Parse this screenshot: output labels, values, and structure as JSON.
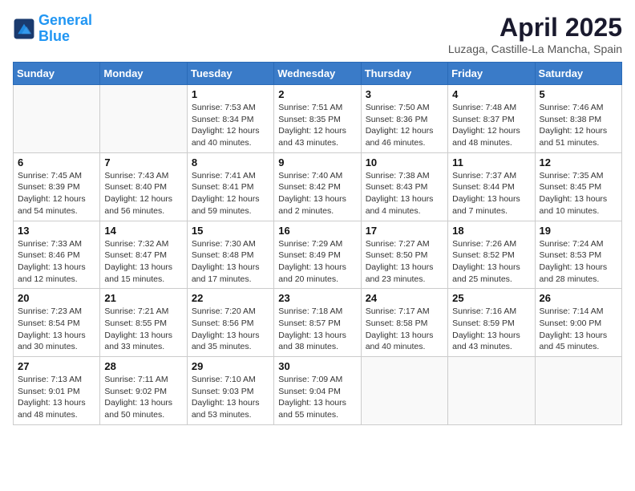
{
  "logo": {
    "line1": "General",
    "line2": "Blue"
  },
  "title": "April 2025",
  "location": "Luzaga, Castille-La Mancha, Spain",
  "weekdays": [
    "Sunday",
    "Monday",
    "Tuesday",
    "Wednesday",
    "Thursday",
    "Friday",
    "Saturday"
  ],
  "weeks": [
    [
      {
        "day": "",
        "sunrise": "",
        "sunset": "",
        "daylight": ""
      },
      {
        "day": "",
        "sunrise": "",
        "sunset": "",
        "daylight": ""
      },
      {
        "day": "1",
        "sunrise": "Sunrise: 7:53 AM",
        "sunset": "Sunset: 8:34 PM",
        "daylight": "Daylight: 12 hours and 40 minutes."
      },
      {
        "day": "2",
        "sunrise": "Sunrise: 7:51 AM",
        "sunset": "Sunset: 8:35 PM",
        "daylight": "Daylight: 12 hours and 43 minutes."
      },
      {
        "day": "3",
        "sunrise": "Sunrise: 7:50 AM",
        "sunset": "Sunset: 8:36 PM",
        "daylight": "Daylight: 12 hours and 46 minutes."
      },
      {
        "day": "4",
        "sunrise": "Sunrise: 7:48 AM",
        "sunset": "Sunset: 8:37 PM",
        "daylight": "Daylight: 12 hours and 48 minutes."
      },
      {
        "day": "5",
        "sunrise": "Sunrise: 7:46 AM",
        "sunset": "Sunset: 8:38 PM",
        "daylight": "Daylight: 12 hours and 51 minutes."
      }
    ],
    [
      {
        "day": "6",
        "sunrise": "Sunrise: 7:45 AM",
        "sunset": "Sunset: 8:39 PM",
        "daylight": "Daylight: 12 hours and 54 minutes."
      },
      {
        "day": "7",
        "sunrise": "Sunrise: 7:43 AM",
        "sunset": "Sunset: 8:40 PM",
        "daylight": "Daylight: 12 hours and 56 minutes."
      },
      {
        "day": "8",
        "sunrise": "Sunrise: 7:41 AM",
        "sunset": "Sunset: 8:41 PM",
        "daylight": "Daylight: 12 hours and 59 minutes."
      },
      {
        "day": "9",
        "sunrise": "Sunrise: 7:40 AM",
        "sunset": "Sunset: 8:42 PM",
        "daylight": "Daylight: 13 hours and 2 minutes."
      },
      {
        "day": "10",
        "sunrise": "Sunrise: 7:38 AM",
        "sunset": "Sunset: 8:43 PM",
        "daylight": "Daylight: 13 hours and 4 minutes."
      },
      {
        "day": "11",
        "sunrise": "Sunrise: 7:37 AM",
        "sunset": "Sunset: 8:44 PM",
        "daylight": "Daylight: 13 hours and 7 minutes."
      },
      {
        "day": "12",
        "sunrise": "Sunrise: 7:35 AM",
        "sunset": "Sunset: 8:45 PM",
        "daylight": "Daylight: 13 hours and 10 minutes."
      }
    ],
    [
      {
        "day": "13",
        "sunrise": "Sunrise: 7:33 AM",
        "sunset": "Sunset: 8:46 PM",
        "daylight": "Daylight: 13 hours and 12 minutes."
      },
      {
        "day": "14",
        "sunrise": "Sunrise: 7:32 AM",
        "sunset": "Sunset: 8:47 PM",
        "daylight": "Daylight: 13 hours and 15 minutes."
      },
      {
        "day": "15",
        "sunrise": "Sunrise: 7:30 AM",
        "sunset": "Sunset: 8:48 PM",
        "daylight": "Daylight: 13 hours and 17 minutes."
      },
      {
        "day": "16",
        "sunrise": "Sunrise: 7:29 AM",
        "sunset": "Sunset: 8:49 PM",
        "daylight": "Daylight: 13 hours and 20 minutes."
      },
      {
        "day": "17",
        "sunrise": "Sunrise: 7:27 AM",
        "sunset": "Sunset: 8:50 PM",
        "daylight": "Daylight: 13 hours and 23 minutes."
      },
      {
        "day": "18",
        "sunrise": "Sunrise: 7:26 AM",
        "sunset": "Sunset: 8:52 PM",
        "daylight": "Daylight: 13 hours and 25 minutes."
      },
      {
        "day": "19",
        "sunrise": "Sunrise: 7:24 AM",
        "sunset": "Sunset: 8:53 PM",
        "daylight": "Daylight: 13 hours and 28 minutes."
      }
    ],
    [
      {
        "day": "20",
        "sunrise": "Sunrise: 7:23 AM",
        "sunset": "Sunset: 8:54 PM",
        "daylight": "Daylight: 13 hours and 30 minutes."
      },
      {
        "day": "21",
        "sunrise": "Sunrise: 7:21 AM",
        "sunset": "Sunset: 8:55 PM",
        "daylight": "Daylight: 13 hours and 33 minutes."
      },
      {
        "day": "22",
        "sunrise": "Sunrise: 7:20 AM",
        "sunset": "Sunset: 8:56 PM",
        "daylight": "Daylight: 13 hours and 35 minutes."
      },
      {
        "day": "23",
        "sunrise": "Sunrise: 7:18 AM",
        "sunset": "Sunset: 8:57 PM",
        "daylight": "Daylight: 13 hours and 38 minutes."
      },
      {
        "day": "24",
        "sunrise": "Sunrise: 7:17 AM",
        "sunset": "Sunset: 8:58 PM",
        "daylight": "Daylight: 13 hours and 40 minutes."
      },
      {
        "day": "25",
        "sunrise": "Sunrise: 7:16 AM",
        "sunset": "Sunset: 8:59 PM",
        "daylight": "Daylight: 13 hours and 43 minutes."
      },
      {
        "day": "26",
        "sunrise": "Sunrise: 7:14 AM",
        "sunset": "Sunset: 9:00 PM",
        "daylight": "Daylight: 13 hours and 45 minutes."
      }
    ],
    [
      {
        "day": "27",
        "sunrise": "Sunrise: 7:13 AM",
        "sunset": "Sunset: 9:01 PM",
        "daylight": "Daylight: 13 hours and 48 minutes."
      },
      {
        "day": "28",
        "sunrise": "Sunrise: 7:11 AM",
        "sunset": "Sunset: 9:02 PM",
        "daylight": "Daylight: 13 hours and 50 minutes."
      },
      {
        "day": "29",
        "sunrise": "Sunrise: 7:10 AM",
        "sunset": "Sunset: 9:03 PM",
        "daylight": "Daylight: 13 hours and 53 minutes."
      },
      {
        "day": "30",
        "sunrise": "Sunrise: 7:09 AM",
        "sunset": "Sunset: 9:04 PM",
        "daylight": "Daylight: 13 hours and 55 minutes."
      },
      {
        "day": "",
        "sunrise": "",
        "sunset": "",
        "daylight": ""
      },
      {
        "day": "",
        "sunrise": "",
        "sunset": "",
        "daylight": ""
      },
      {
        "day": "",
        "sunrise": "",
        "sunset": "",
        "daylight": ""
      }
    ]
  ]
}
